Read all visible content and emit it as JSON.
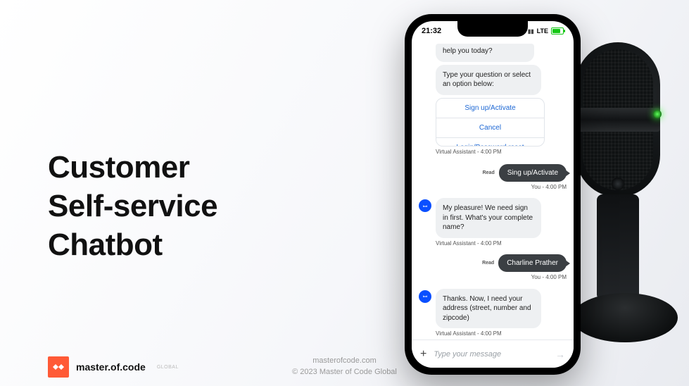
{
  "heading": {
    "line1": "Customer",
    "line2": "Self-service",
    "line3": "Chatbot"
  },
  "brand": {
    "name": "master.of.code",
    "sub": "GLOBAL"
  },
  "footer": {
    "domain": "masterofcode.com",
    "copyright": "© 2023 Master of Code Global"
  },
  "status": {
    "time": "21:32",
    "net": "LTE"
  },
  "chat": {
    "bot_name": "Virtual Assistant",
    "help_tail": "help you today?",
    "prompt": "Type your question or select an option below:",
    "options": {
      "signup": "Sign up/Activate",
      "cancel": "Cancel",
      "login": "Login/Password reset"
    },
    "meta_va": "Virtual Assistant - 4:00 PM",
    "read_label": "Read",
    "user1": "Sing up/Activate",
    "meta_you": "You - 4:00 PM",
    "bot2": "My pleasure! We need sign in first. What's your complete name?",
    "user2": "Charline Prather",
    "bot3": "Thanks. Now, I need your address (street, number and zipcode)"
  },
  "composer": {
    "placeholder": "Type your message"
  }
}
